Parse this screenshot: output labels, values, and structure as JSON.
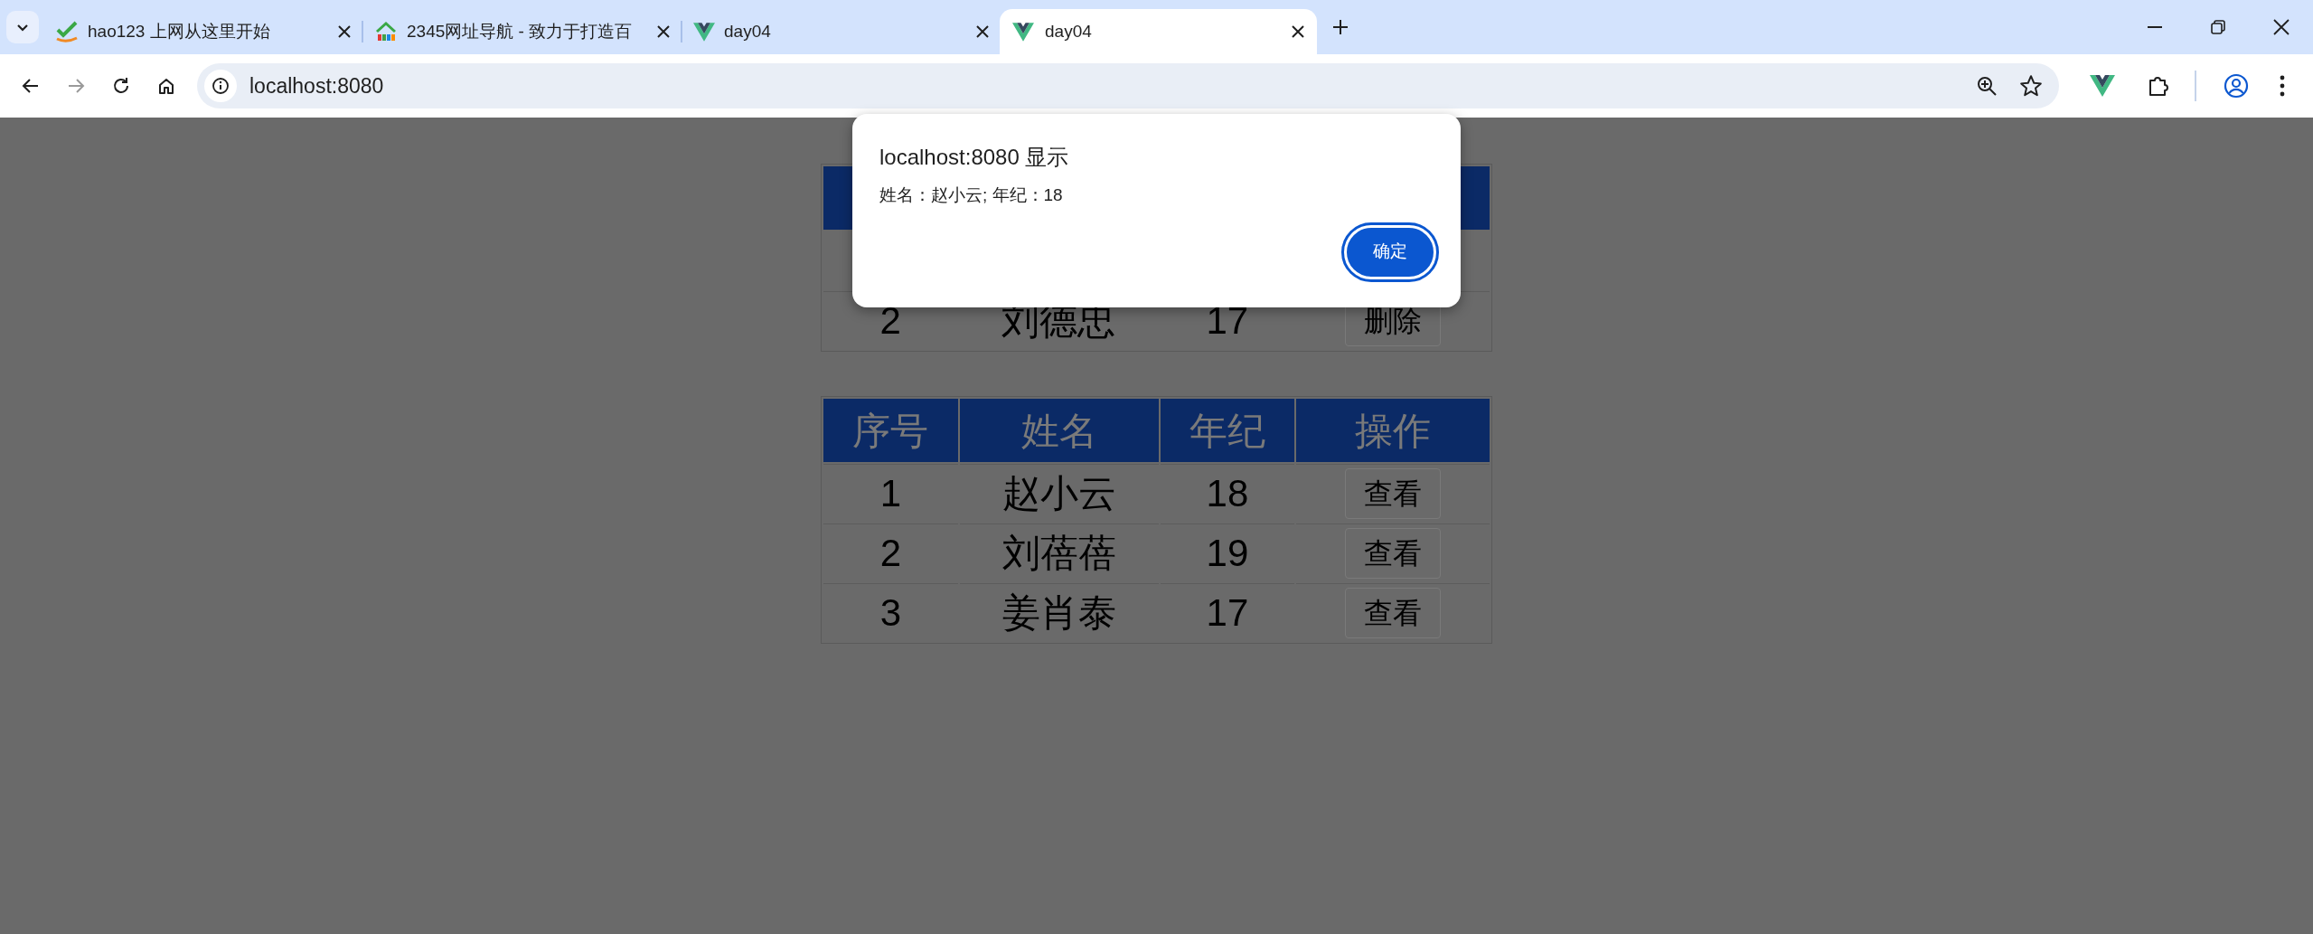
{
  "browser": {
    "tabs": [
      {
        "title": "hao123 上网从这里开始",
        "kind": "hao",
        "selected": false
      },
      {
        "title": "2345网址导航 - 致力于打造百",
        "kind": "house",
        "selected": false
      },
      {
        "title": "day04",
        "kind": "vue",
        "selected": false
      },
      {
        "title": "day04",
        "kind": "vue",
        "selected": true
      }
    ],
    "address": "localhost:8080"
  },
  "tables": [
    {
      "rows": [
        {
          "cells": [
            "2",
            "刘德忠",
            "17"
          ],
          "action": "删除"
        }
      ]
    },
    {
      "columns": [
        "序号",
        "姓名",
        "年纪",
        "操作"
      ],
      "rows": [
        {
          "cells": [
            "1",
            "赵小云",
            "18"
          ],
          "action": "查看"
        },
        {
          "cells": [
            "2",
            "刘蓓蓓",
            "19"
          ],
          "action": "查看"
        },
        {
          "cells": [
            "3",
            "姜肖泰",
            "17"
          ],
          "action": "查看"
        }
      ]
    }
  ],
  "dialog": {
    "title": "localhost:8080 显示",
    "message": "姓名：赵小云; 年纪：18",
    "button": "确定"
  }
}
